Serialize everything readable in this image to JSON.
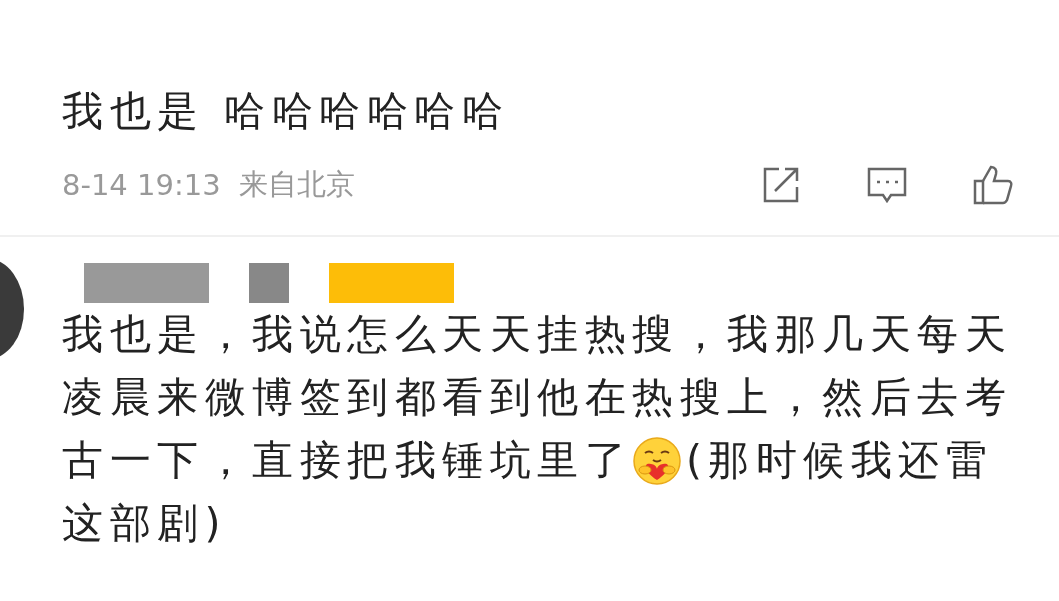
{
  "comments": [
    {
      "kind": "plain",
      "lines": [
        [
          {
            "kind": "text",
            "text": "我也是 哈哈哈哈哈哈"
          }
        ]
      ],
      "time": "8-14 19:13",
      "location": "来自北京",
      "actions": [
        {
          "kind": "share"
        },
        {
          "kind": "comment"
        },
        {
          "kind": "like"
        }
      ]
    },
    {
      "kind": "with_avatar",
      "lines": [
        [
          {
            "kind": "text",
            "text": "我也是，我说怎么天天挂热搜，我那几天每天"
          }
        ],
        [
          {
            "kind": "text",
            "text": "凌晨来微博签到都看到他在热搜上，然后去考"
          }
        ],
        [
          {
            "kind": "text",
            "text": "古一下，直接把我锤坑里了"
          },
          {
            "kind": "emoji"
          },
          {
            "kind": "text",
            "text": "(那时候我还雷"
          }
        ],
        [
          {
            "kind": "text",
            "text": "这部剧)"
          }
        ]
      ]
    }
  ]
}
